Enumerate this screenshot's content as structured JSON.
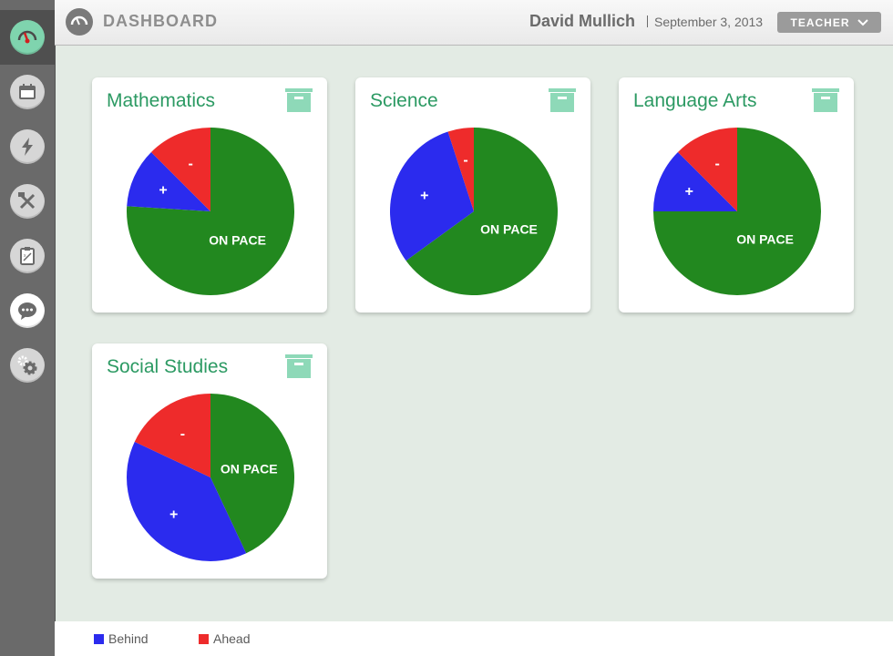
{
  "colors": {
    "on_pace": "#22881f",
    "behind": "#2b2bee",
    "ahead": "#ee2b2b",
    "accent": "#2c9a63",
    "icon_green": "#7fd4ae"
  },
  "sidebar": {
    "items": [
      {
        "icon": "gauge-icon",
        "active": true
      },
      {
        "icon": "calendar-icon",
        "active": false
      },
      {
        "icon": "lightning-icon",
        "active": false
      },
      {
        "icon": "tools-icon",
        "active": false
      },
      {
        "icon": "clipboard-icon",
        "active": false
      },
      {
        "icon": "chat-icon",
        "active": false
      },
      {
        "icon": "settings-icon",
        "active": false
      }
    ]
  },
  "header": {
    "title": "DASHBOARD",
    "user_name": "David Mullich",
    "date": "September 3, 2013",
    "role": "TEACHER"
  },
  "subjects": [
    {
      "title": "Mathematics",
      "label_on_pace": "ON PACE",
      "label_behind": "+",
      "label_ahead": "-"
    },
    {
      "title": "Science",
      "label_on_pace": "ON PACE",
      "label_behind": "+",
      "label_ahead": "-"
    },
    {
      "title": "Language Arts",
      "label_on_pace": "ON PACE",
      "label_behind": "+",
      "label_ahead": "-"
    },
    {
      "title": "Social Studies",
      "label_on_pace": "ON PACE",
      "label_behind": "+",
      "label_ahead": "-"
    }
  ],
  "chart_data": [
    {
      "type": "pie",
      "title": "Mathematics",
      "categories": [
        "ON PACE",
        "+",
        "-"
      ],
      "values": [
        76,
        11.5,
        12.5
      ]
    },
    {
      "type": "pie",
      "title": "Science",
      "categories": [
        "ON PACE",
        "+",
        "-"
      ],
      "values": [
        65,
        30,
        5
      ]
    },
    {
      "type": "pie",
      "title": "Language Arts",
      "categories": [
        "ON PACE",
        "+",
        "-"
      ],
      "values": [
        75,
        12.5,
        12.5
      ]
    },
    {
      "type": "pie",
      "title": "Social Studies",
      "categories": [
        "ON PACE",
        "+",
        "-"
      ],
      "values": [
        43,
        39,
        18
      ]
    }
  ],
  "legend": {
    "items": [
      {
        "label": "Behind",
        "color": "#2b2bee"
      },
      {
        "label": "Ahead",
        "color": "#ee2b2b"
      }
    ]
  }
}
